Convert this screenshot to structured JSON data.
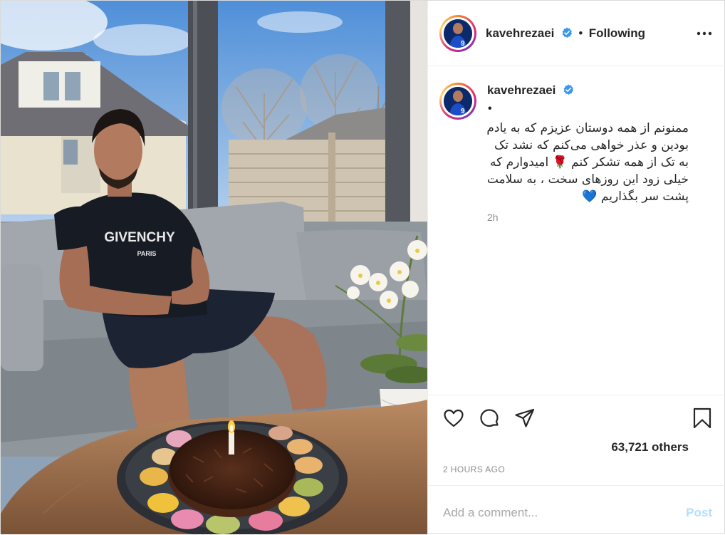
{
  "post": {
    "author": "kavehrezaei",
    "follow_status": "Following",
    "separator": "•",
    "caption_user": "kavehrezaei",
    "caption_bullet": "•",
    "caption": "ممنونم از همه دوستان عزیزم که به یادم بودین و عذر خواهی می‌کنم که نشد تک به تک از همه تشکر کنم 🌹 امیدوارم که خیلی زود این روزهای سخت ، به سلامت پشت سر بگذاریم 💙",
    "caption_time": "2h",
    "likes": "63,721 others",
    "posted_ago": "2 HOURS AGO",
    "comment_placeholder": "Add a comment...",
    "post_label": "Post",
    "photo_text": {
      "shirt_brand": "GIVENCHY",
      "shirt_city": "PARIS",
      "jersey_number": "9"
    }
  },
  "icons": {
    "verified": "verified-badge-icon",
    "more": "more-options-icon",
    "like": "heart-icon",
    "comment": "comment-icon",
    "share": "share-icon",
    "save": "bookmark-icon"
  },
  "colors": {
    "verified": "#3897f0",
    "text": "#262626",
    "muted": "#8e8e8e",
    "post_disabled": "#b2dffc",
    "border": "#efefef"
  }
}
